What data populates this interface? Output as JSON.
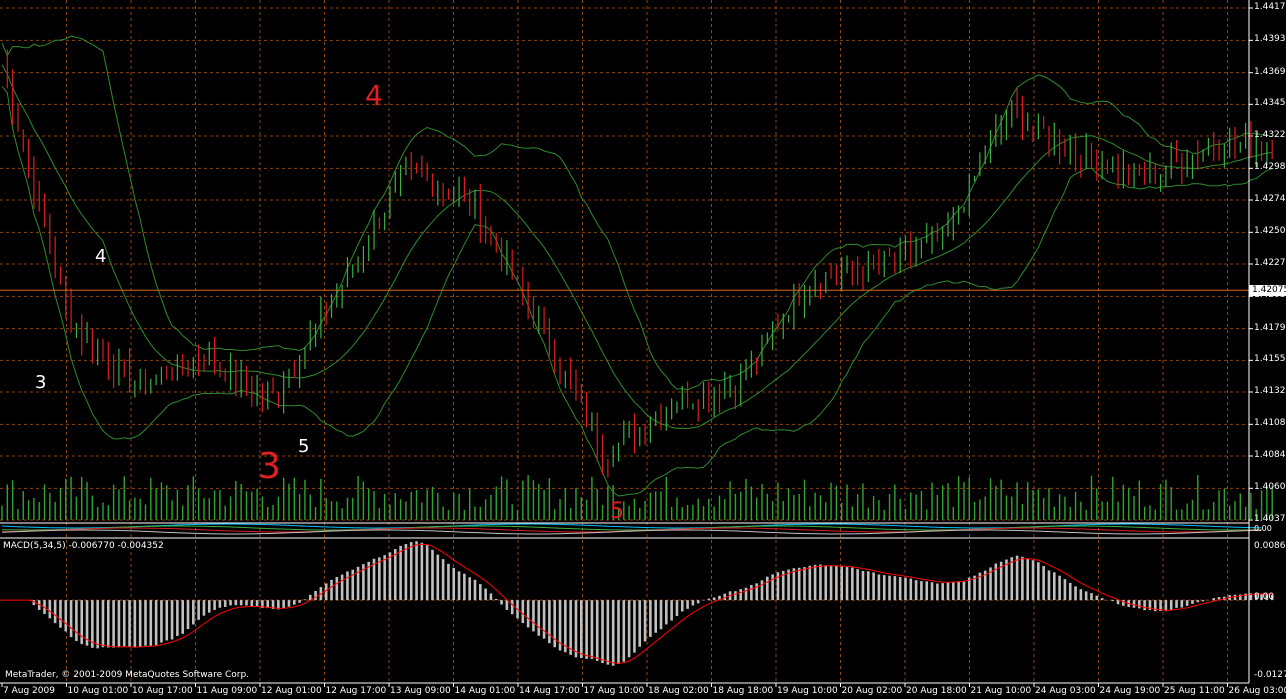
{
  "platform": {
    "copyright": "MetaTrader, © 2001-2009 MetaQuotes Software Corp."
  },
  "colors": {
    "background": "#000000",
    "grid": "#8b4513",
    "bull_candle": "#3cb043",
    "bear_candle": "#d81e1e",
    "bands": "#2e8b2e",
    "volume": "#2fa52f",
    "macd_histogram": "#c0c0c0",
    "macd_signal": "#ff0000",
    "current_price_line": "#d2691e",
    "annotation_red": "#e02020",
    "annotation_white": "#ffffff"
  },
  "price_axis": {
    "ticks": [
      "1.44170",
      "1.43930",
      "1.43690",
      "1.43455",
      "1.43220",
      "1.42980",
      "1.42745",
      "1.42505",
      "1.42270",
      "1.42030",
      "1.41790",
      "1.41555",
      "1.41320",
      "1.41080",
      "1.40845",
      "1.40605",
      "1.40370"
    ],
    "current_price": "1.42075"
  },
  "time_axis": {
    "ticks": [
      "7 Aug 2009",
      "10 Aug 01:00",
      "10 Aug 17:00",
      "11 Aug 09:00",
      "12 Aug 01:00",
      "12 Aug 17:00",
      "13 Aug 09:00",
      "14 Aug 01:00",
      "14 Aug 17:00",
      "17 Aug 10:00",
      "18 Aug 02:00",
      "18 Aug 18:00",
      "19 Aug 10:00",
      "20 Aug 02:00",
      "20 Aug 18:00",
      "21 Aug 10:00",
      "24 Aug 03:00",
      "24 Aug 19:00",
      "25 Aug 11:00",
      "26 Aug 03:00"
    ]
  },
  "indicator_strip": {
    "axis_label": "0.00"
  },
  "macd_panel": {
    "label": "MACD(5,34,5) -0.006770 -0.004352",
    "axis_ticks": [
      "0.008670",
      "0.00",
      "-0.012796"
    ]
  },
  "annotations": [
    {
      "text": "4",
      "color": "red"
    },
    {
      "text": "4",
      "color": "white"
    },
    {
      "text": "3",
      "color": "white"
    },
    {
      "text": "3",
      "color": "red"
    },
    {
      "text": "5",
      "color": "white"
    },
    {
      "text": "5",
      "color": "red"
    }
  ],
  "chart_data": {
    "type": "candlestick",
    "symbol": "",
    "price_range": [
      1.4037,
      1.4417
    ],
    "bollinger_bands": true,
    "volume": true,
    "approx_close_path": [
      {
        "x": "7 Aug 2009",
        "close": 1.4375
      },
      {
        "x": "10 Aug 01:00",
        "close": 1.4185
      },
      {
        "x": "10 Aug 17:00",
        "close": 1.4135
      },
      {
        "x": "11 Aug 09:00",
        "close": 1.416
      },
      {
        "x": "12 Aug 01:00",
        "close": 1.4125
      },
      {
        "x": "12 Aug 17:00",
        "close": 1.4205
      },
      {
        "x": "13 Aug 09:00",
        "close": 1.4295
      },
      {
        "x": "14 Aug 01:00",
        "close": 1.4275
      },
      {
        "x": "14 Aug 17:00",
        "close": 1.418
      },
      {
        "x": "17 Aug 10:00",
        "close": 1.4085
      },
      {
        "x": "18 Aug 02:00",
        "close": 1.4125
      },
      {
        "x": "18 Aug 18:00",
        "close": 1.414
      },
      {
        "x": "19 Aug 10:00",
        "close": 1.4215
      },
      {
        "x": "20 Aug 02:00",
        "close": 1.4225
      },
      {
        "x": "20 Aug 18:00",
        "close": 1.4245
      },
      {
        "x": "21 Aug 10:00",
        "close": 1.434
      },
      {
        "x": "24 Aug 03:00",
        "close": 1.431
      },
      {
        "x": "24 Aug 19:00",
        "close": 1.429
      },
      {
        "x": "25 Aug 11:00",
        "close": 1.4315
      },
      {
        "x": "26 Aug 03:00",
        "close": 1.4315
      }
    ],
    "macd": {
      "params": "5,34,5",
      "value": -0.00677,
      "signal": -0.004352,
      "ylim": [
        -0.012796,
        0.00867
      ]
    }
  }
}
